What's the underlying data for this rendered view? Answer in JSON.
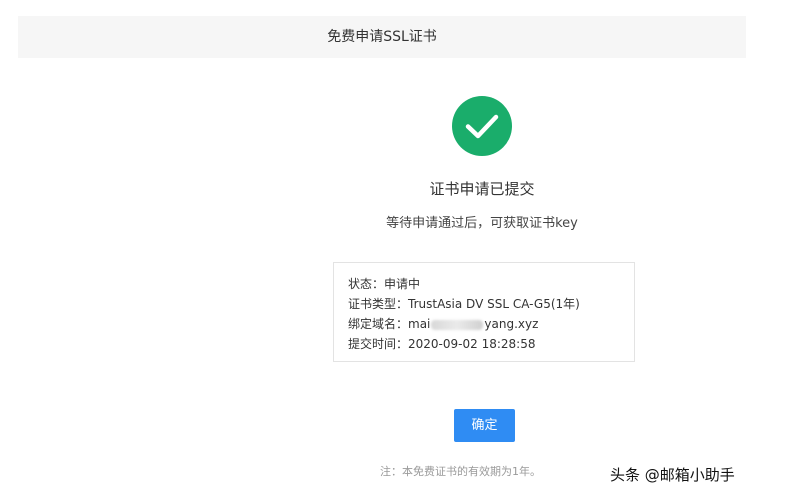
{
  "header": {
    "title": "免费申请SSL证书"
  },
  "result": {
    "icon": "check-circle-icon",
    "icon_color": "#1aad6b",
    "title": "证书申请已提交",
    "description": "等待申请通过后，可获取证书key"
  },
  "info": {
    "status_label": "状态：",
    "status_value": "申请中",
    "type_label": "证书类型：",
    "type_value": "TrustAsia DV SSL CA-G5(1年)",
    "domain_label": "绑定域名：",
    "domain_prefix": "mai",
    "domain_suffix": "yang.xyz",
    "time_label": "提交时间：",
    "time_value": "2020-09-02 18:28:58"
  },
  "actions": {
    "confirm_label": "确定",
    "confirm_color": "#2f8cf3"
  },
  "footer": {
    "note": "注：本免费证书的有效期为1年。"
  },
  "watermark": {
    "text": "头条 @邮箱小助手"
  }
}
